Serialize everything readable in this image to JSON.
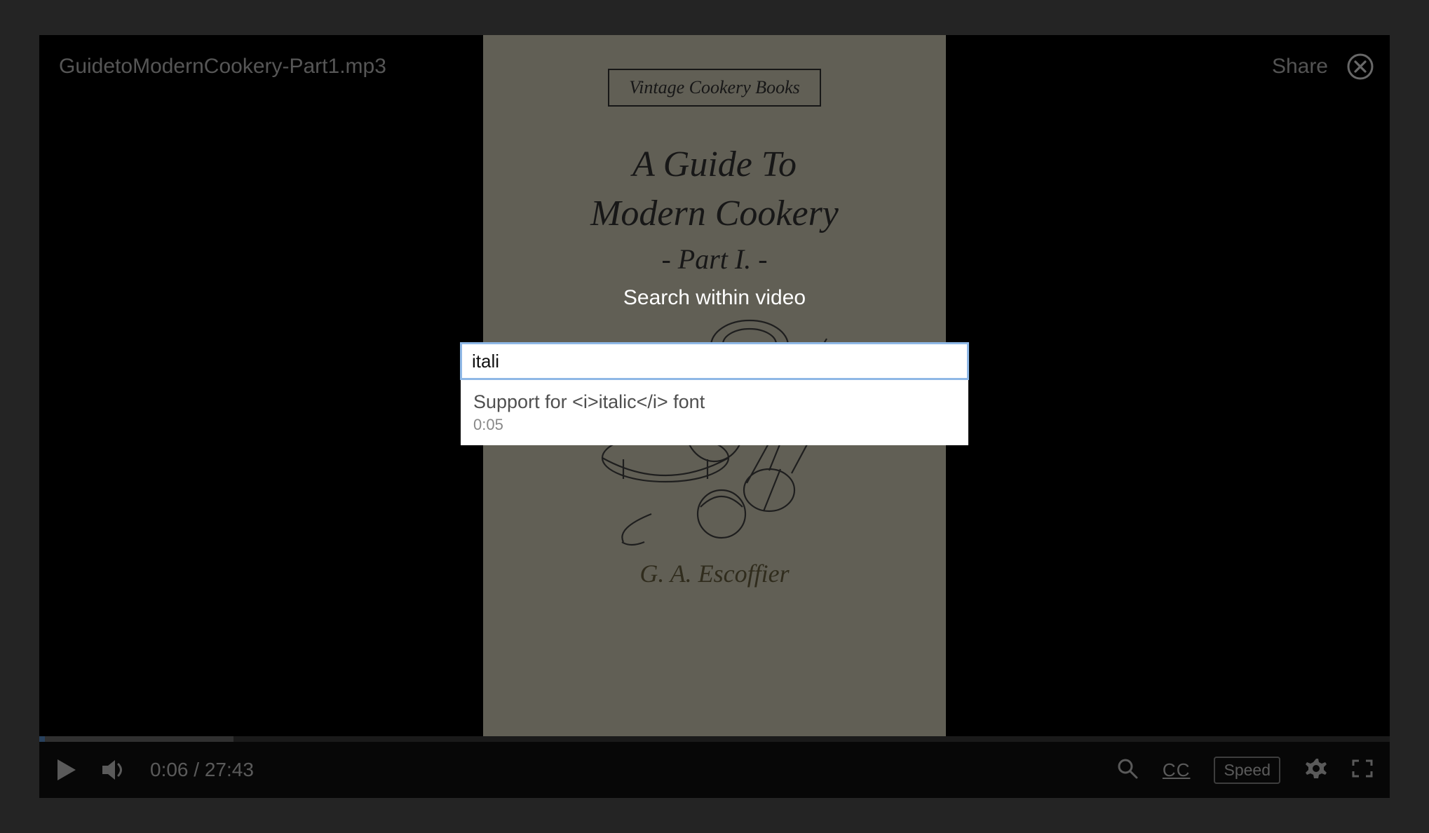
{
  "topbar": {
    "filename": "GuidetoModernCookery-Part1.mp3",
    "share_label": "Share"
  },
  "artwork": {
    "imprint": "Vintage Cookery Books",
    "title_line1": "A Guide To",
    "title_line2": "Modern Cookery",
    "part": "- Part I. -",
    "author": "G. A. Escoffier"
  },
  "search": {
    "heading": "Search within video",
    "query": "itali",
    "result": {
      "text": "Support for <i>italic</i> font",
      "timestamp": "0:05"
    }
  },
  "controls": {
    "current_time": "0:06",
    "duration": "27:43",
    "separator": " / ",
    "cc_label": "CC",
    "speed_label": "Speed"
  }
}
